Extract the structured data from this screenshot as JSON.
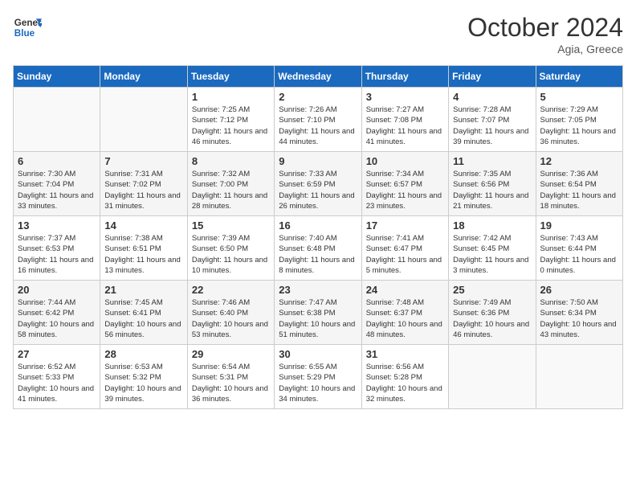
{
  "header": {
    "logo_line1": "General",
    "logo_line2": "Blue",
    "month": "October 2024",
    "location": "Agia, Greece"
  },
  "days_of_week": [
    "Sunday",
    "Monday",
    "Tuesday",
    "Wednesday",
    "Thursday",
    "Friday",
    "Saturday"
  ],
  "weeks": [
    [
      {
        "day": "",
        "info": ""
      },
      {
        "day": "",
        "info": ""
      },
      {
        "day": "1",
        "info": "Sunrise: 7:25 AM\nSunset: 7:12 PM\nDaylight: 11 hours and 46 minutes."
      },
      {
        "day": "2",
        "info": "Sunrise: 7:26 AM\nSunset: 7:10 PM\nDaylight: 11 hours and 44 minutes."
      },
      {
        "day": "3",
        "info": "Sunrise: 7:27 AM\nSunset: 7:08 PM\nDaylight: 11 hours and 41 minutes."
      },
      {
        "day": "4",
        "info": "Sunrise: 7:28 AM\nSunset: 7:07 PM\nDaylight: 11 hours and 39 minutes."
      },
      {
        "day": "5",
        "info": "Sunrise: 7:29 AM\nSunset: 7:05 PM\nDaylight: 11 hours and 36 minutes."
      }
    ],
    [
      {
        "day": "6",
        "info": "Sunrise: 7:30 AM\nSunset: 7:04 PM\nDaylight: 11 hours and 33 minutes."
      },
      {
        "day": "7",
        "info": "Sunrise: 7:31 AM\nSunset: 7:02 PM\nDaylight: 11 hours and 31 minutes."
      },
      {
        "day": "8",
        "info": "Sunrise: 7:32 AM\nSunset: 7:00 PM\nDaylight: 11 hours and 28 minutes."
      },
      {
        "day": "9",
        "info": "Sunrise: 7:33 AM\nSunset: 6:59 PM\nDaylight: 11 hours and 26 minutes."
      },
      {
        "day": "10",
        "info": "Sunrise: 7:34 AM\nSunset: 6:57 PM\nDaylight: 11 hours and 23 minutes."
      },
      {
        "day": "11",
        "info": "Sunrise: 7:35 AM\nSunset: 6:56 PM\nDaylight: 11 hours and 21 minutes."
      },
      {
        "day": "12",
        "info": "Sunrise: 7:36 AM\nSunset: 6:54 PM\nDaylight: 11 hours and 18 minutes."
      }
    ],
    [
      {
        "day": "13",
        "info": "Sunrise: 7:37 AM\nSunset: 6:53 PM\nDaylight: 11 hours and 16 minutes."
      },
      {
        "day": "14",
        "info": "Sunrise: 7:38 AM\nSunset: 6:51 PM\nDaylight: 11 hours and 13 minutes."
      },
      {
        "day": "15",
        "info": "Sunrise: 7:39 AM\nSunset: 6:50 PM\nDaylight: 11 hours and 10 minutes."
      },
      {
        "day": "16",
        "info": "Sunrise: 7:40 AM\nSunset: 6:48 PM\nDaylight: 11 hours and 8 minutes."
      },
      {
        "day": "17",
        "info": "Sunrise: 7:41 AM\nSunset: 6:47 PM\nDaylight: 11 hours and 5 minutes."
      },
      {
        "day": "18",
        "info": "Sunrise: 7:42 AM\nSunset: 6:45 PM\nDaylight: 11 hours and 3 minutes."
      },
      {
        "day": "19",
        "info": "Sunrise: 7:43 AM\nSunset: 6:44 PM\nDaylight: 11 hours and 0 minutes."
      }
    ],
    [
      {
        "day": "20",
        "info": "Sunrise: 7:44 AM\nSunset: 6:42 PM\nDaylight: 10 hours and 58 minutes."
      },
      {
        "day": "21",
        "info": "Sunrise: 7:45 AM\nSunset: 6:41 PM\nDaylight: 10 hours and 56 minutes."
      },
      {
        "day": "22",
        "info": "Sunrise: 7:46 AM\nSunset: 6:40 PM\nDaylight: 10 hours and 53 minutes."
      },
      {
        "day": "23",
        "info": "Sunrise: 7:47 AM\nSunset: 6:38 PM\nDaylight: 10 hours and 51 minutes."
      },
      {
        "day": "24",
        "info": "Sunrise: 7:48 AM\nSunset: 6:37 PM\nDaylight: 10 hours and 48 minutes."
      },
      {
        "day": "25",
        "info": "Sunrise: 7:49 AM\nSunset: 6:36 PM\nDaylight: 10 hours and 46 minutes."
      },
      {
        "day": "26",
        "info": "Sunrise: 7:50 AM\nSunset: 6:34 PM\nDaylight: 10 hours and 43 minutes."
      }
    ],
    [
      {
        "day": "27",
        "info": "Sunrise: 6:52 AM\nSunset: 5:33 PM\nDaylight: 10 hours and 41 minutes."
      },
      {
        "day": "28",
        "info": "Sunrise: 6:53 AM\nSunset: 5:32 PM\nDaylight: 10 hours and 39 minutes."
      },
      {
        "day": "29",
        "info": "Sunrise: 6:54 AM\nSunset: 5:31 PM\nDaylight: 10 hours and 36 minutes."
      },
      {
        "day": "30",
        "info": "Sunrise: 6:55 AM\nSunset: 5:29 PM\nDaylight: 10 hours and 34 minutes."
      },
      {
        "day": "31",
        "info": "Sunrise: 6:56 AM\nSunset: 5:28 PM\nDaylight: 10 hours and 32 minutes."
      },
      {
        "day": "",
        "info": ""
      },
      {
        "day": "",
        "info": ""
      }
    ]
  ]
}
